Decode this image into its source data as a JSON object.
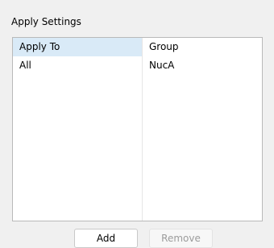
{
  "group": {
    "title": "Apply Settings"
  },
  "table": {
    "columns": [
      "Apply To",
      "Group"
    ],
    "rows": [
      [
        "All",
        "NucA"
      ]
    ]
  },
  "buttons": {
    "add_label": "Add",
    "remove_label": "Remove",
    "remove_enabled": false
  },
  "colors": {
    "header_highlight": "#d9eaf7",
    "panel_bg": "#f0f0f0",
    "disabled_text": "#9c9c9c"
  }
}
